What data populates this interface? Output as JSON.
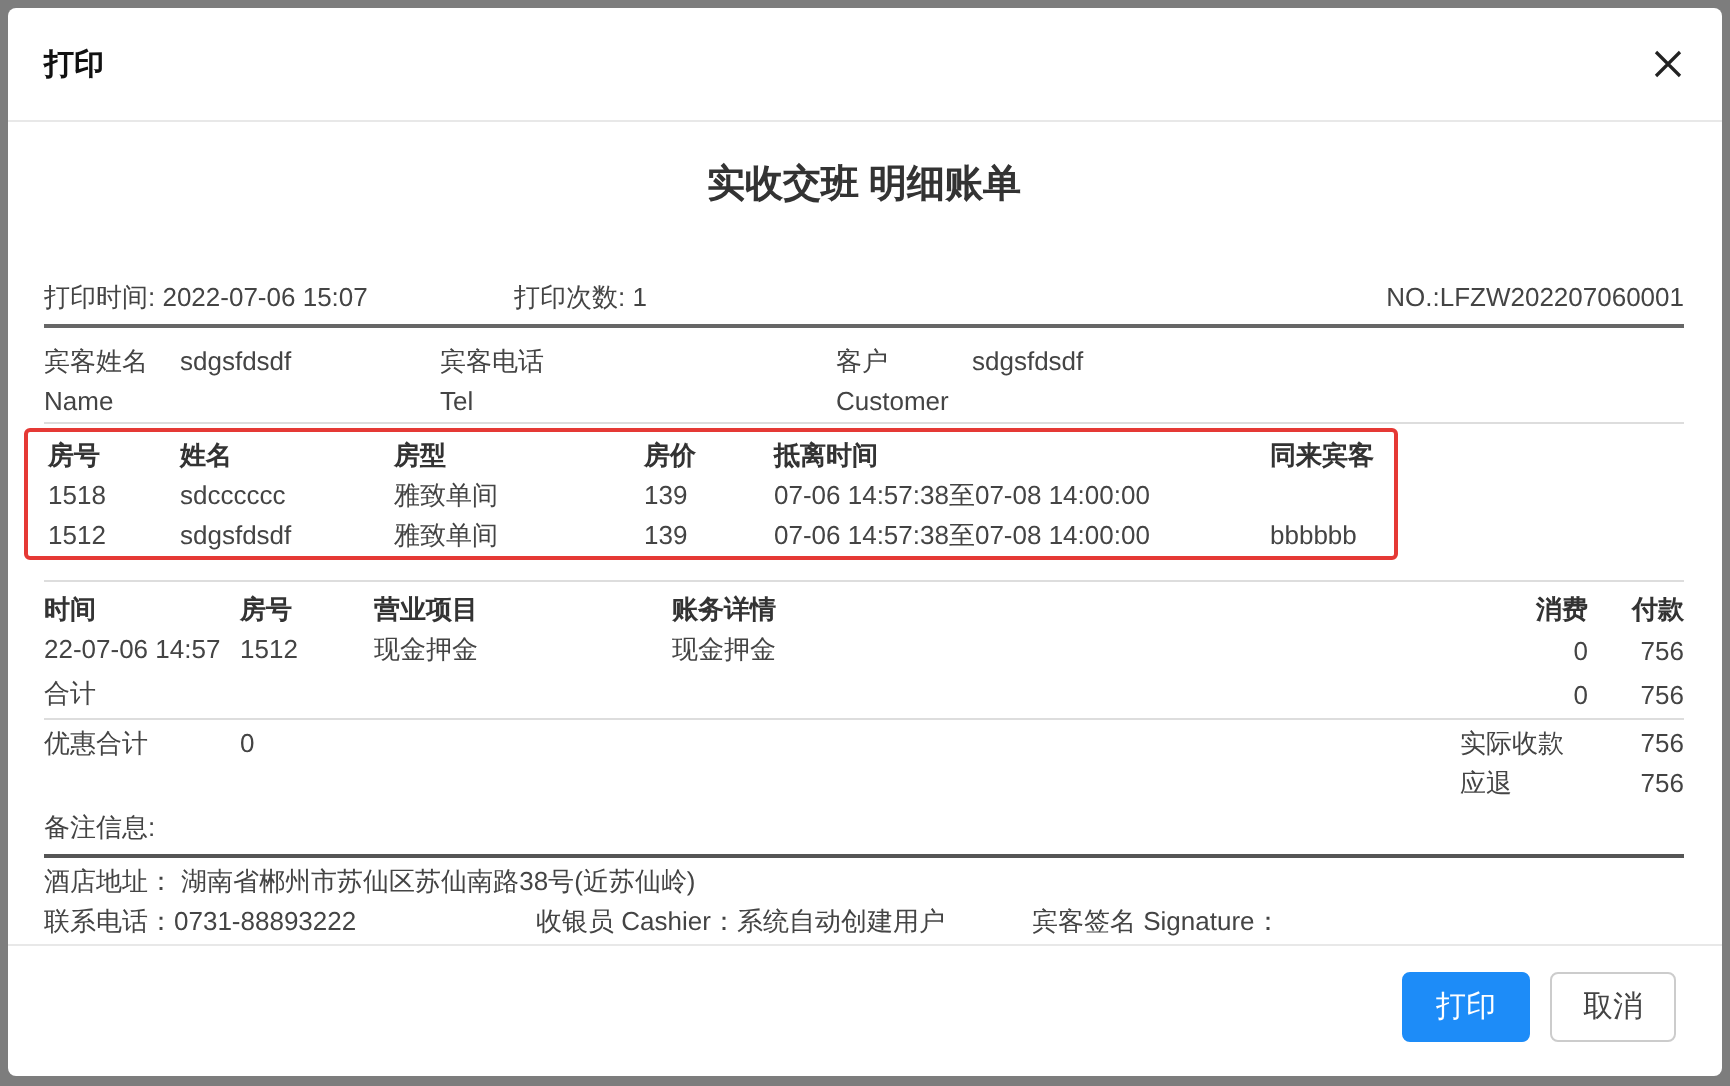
{
  "dialog": {
    "title": "打印"
  },
  "document": {
    "title": "实收交班 明细账单",
    "meta": [
      {
        "text": "打印时间: 2022-07-06 15:07"
      },
      {
        "text": "打印次数: 1"
      },
      {
        "text": "NO.:LFZW202207060001"
      }
    ],
    "guest": [
      {
        "label": "宾客姓名",
        "sublabel": "Name",
        "value": "sdgsfdsdf"
      },
      {
        "label": "宾客电话",
        "sublabel": "Tel"
      },
      {
        "label": "客户",
        "sublabel": "Customer",
        "value": "sdgsfdsdf"
      }
    ],
    "rooms": {
      "highlighted": true,
      "columns": [
        "房号",
        "姓名",
        "房型",
        "房价",
        "抵离时间",
        "同来宾客"
      ],
      "rows": [
        [
          "1518",
          "sdcccccc",
          "雅致单间",
          "139",
          "07-06 14:57:38至07-08 14:00:00",
          ""
        ],
        [
          "1512",
          "sdgsfdsdf",
          "雅致单间",
          "139",
          "07-06 14:57:38至07-08 14:00:00",
          "bbbbbb"
        ]
      ]
    },
    "ledger": {
      "columns": [
        "时间",
        "房号",
        "营业项目",
        "账务详情",
        "消费",
        "付款"
      ],
      "rows": [
        [
          "22-07-06 14:57",
          "1512",
          "现金押金",
          "现金押金",
          "0",
          "756"
        ]
      ],
      "total": {
        "label": "合计",
        "values": [
          "0",
          "756"
        ]
      }
    },
    "summary": {
      "discount_label": "优惠合计",
      "discount_value": "0",
      "lines": [
        {
          "label": "实际收款",
          "value": "756"
        },
        {
          "label": "应退",
          "value": "756"
        }
      ]
    },
    "remark_label": "备注信息:",
    "address": "酒店地址： 湖南省郴州市苏仙区苏仙南路38号(近苏仙岭)",
    "contacts": [
      "联系电话：0731-88893222",
      "收银员 Cashier：系统自动创建用户",
      "宾客签名 Signature："
    ]
  },
  "buttons": [
    {
      "label": "打印",
      "kind": "primary"
    },
    {
      "label": "取消",
      "kind": "secondary"
    }
  ]
}
